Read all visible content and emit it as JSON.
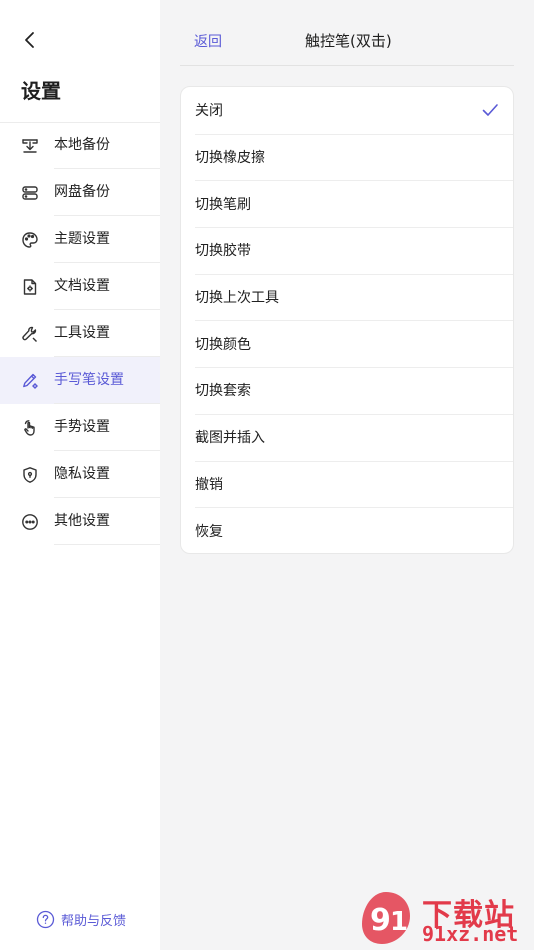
{
  "sidebar": {
    "title": "设置",
    "items": [
      {
        "label": "本地备份",
        "icon": "local-backup-icon"
      },
      {
        "label": "网盘备份",
        "icon": "cloud-backup-icon"
      },
      {
        "label": "主题设置",
        "icon": "palette-icon"
      },
      {
        "label": "文档设置",
        "icon": "document-settings-icon"
      },
      {
        "label": "工具设置",
        "icon": "wrench-icon"
      },
      {
        "label": "手写笔设置",
        "icon": "pen-settings-icon"
      },
      {
        "label": "手势设置",
        "icon": "hand-gesture-icon"
      },
      {
        "label": "隐私设置",
        "icon": "shield-lock-icon"
      },
      {
        "label": "其他设置",
        "icon": "more-icon"
      }
    ],
    "active_index": 5,
    "help_label": "帮助与反馈"
  },
  "header": {
    "back_label": "返回",
    "title": "触控笔(双击)"
  },
  "options": [
    {
      "label": "关闭",
      "selected": true
    },
    {
      "label": "切换橡皮擦",
      "selected": false
    },
    {
      "label": "切换笔刷",
      "selected": false
    },
    {
      "label": "切换胶带",
      "selected": false
    },
    {
      "label": "切换上次工具",
      "selected": false
    },
    {
      "label": "切换颜色",
      "selected": false
    },
    {
      "label": "切换套索",
      "selected": false
    },
    {
      "label": "截图并插入",
      "selected": false
    },
    {
      "label": "撤销",
      "selected": false
    },
    {
      "label": "恢复",
      "selected": false
    }
  ],
  "watermark": {
    "line1": "下载站",
    "line2": "91xz.net"
  },
  "colors": {
    "accent": "#5a5ad6",
    "watermark": "#e23a4a"
  }
}
